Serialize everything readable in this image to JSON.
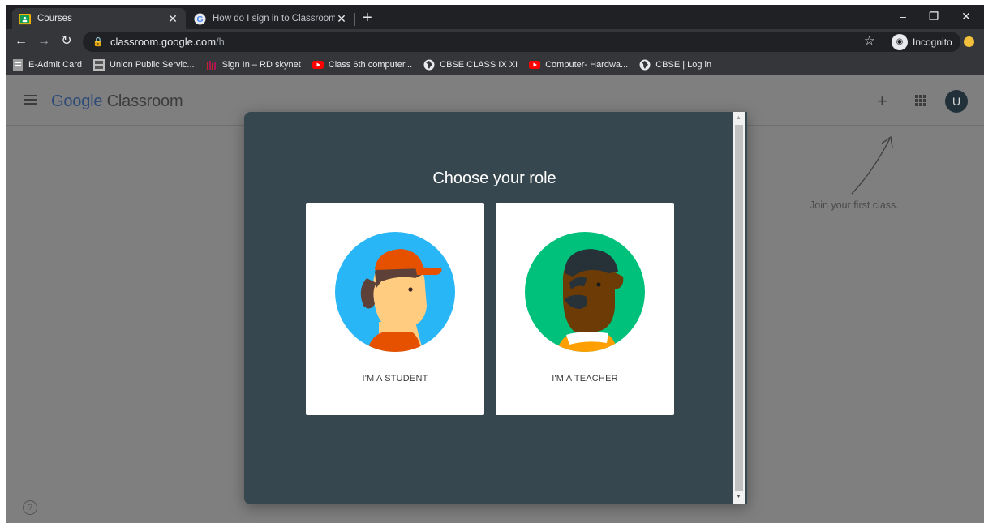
{
  "browser": {
    "tabs": [
      {
        "title": "Courses",
        "active": true
      },
      {
        "title": "How do I sign in to Classroom? -",
        "active": false
      }
    ],
    "close_glyph": "✕",
    "new_tab_glyph": "+",
    "window_controls": {
      "minimize": "–",
      "restore": "❐",
      "close": "✕"
    },
    "url_host": "classroom.google.com",
    "url_path": "/h",
    "incognito_label": "Incognito",
    "bookmarks": [
      {
        "label": "E-Admit Card",
        "icon": "page-icon"
      },
      {
        "label": "Union Public Servic...",
        "icon": "upsc-icon"
      },
      {
        "label": "Sign In – RD skynet",
        "icon": "rd-icon"
      },
      {
        "label": "Class 6th computer...",
        "icon": "youtube-icon"
      },
      {
        "label": "CBSE CLASS IX XI",
        "icon": "globe-icon"
      },
      {
        "label": "Computer- Hardwa...",
        "icon": "youtube-icon"
      },
      {
        "label": "CBSE | Log in",
        "icon": "globe-icon"
      }
    ]
  },
  "app": {
    "logo_google": "Google",
    "logo_product": "Classroom",
    "avatar_initial": "U",
    "join_hint": "Join your first class.",
    "help_glyph": "?"
  },
  "modal": {
    "title": "Choose your role",
    "roles": [
      {
        "label": "I'M A STUDENT"
      },
      {
        "label": "I'M A TEACHER"
      }
    ]
  },
  "colors": {
    "student_bg": "#29b6f6",
    "teacher_bg": "#00c17c",
    "modal_bg": "#37474f",
    "cap": "#e65100"
  }
}
